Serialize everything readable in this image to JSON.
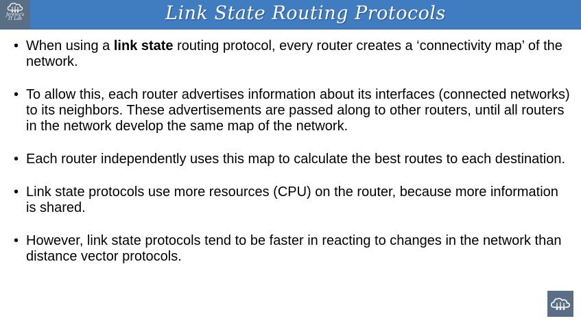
{
  "header": {
    "title": "Link State Routing Protocols",
    "logo_line1": "Jeremy's",
    "logo_line2": "IT Lab",
    "logo_icon": "cloud-network-icon",
    "bar_color": "#3f7cc0"
  },
  "bullets": [
    {
      "before": "When using a ",
      "bold": "link state",
      "after": " routing protocol, every router creates a ‘connectivity map’ of the network."
    },
    {
      "text": "To allow this, each router advertises information about its interfaces (connected networks) to its neighbors.  These advertisements are passed along to other routers, until all routers in the network develop the same map of the network."
    },
    {
      "text": "Each router independently uses this map to calculate the best routes to each destination."
    },
    {
      "text": "Link state protocols use more resources (CPU) on the router, because more information is shared."
    },
    {
      "text": "However, link state protocols tend to be faster in reacting to changes in the network than distance vector protocols."
    }
  ],
  "footer": {
    "logo_icon": "cloud-network-icon"
  }
}
